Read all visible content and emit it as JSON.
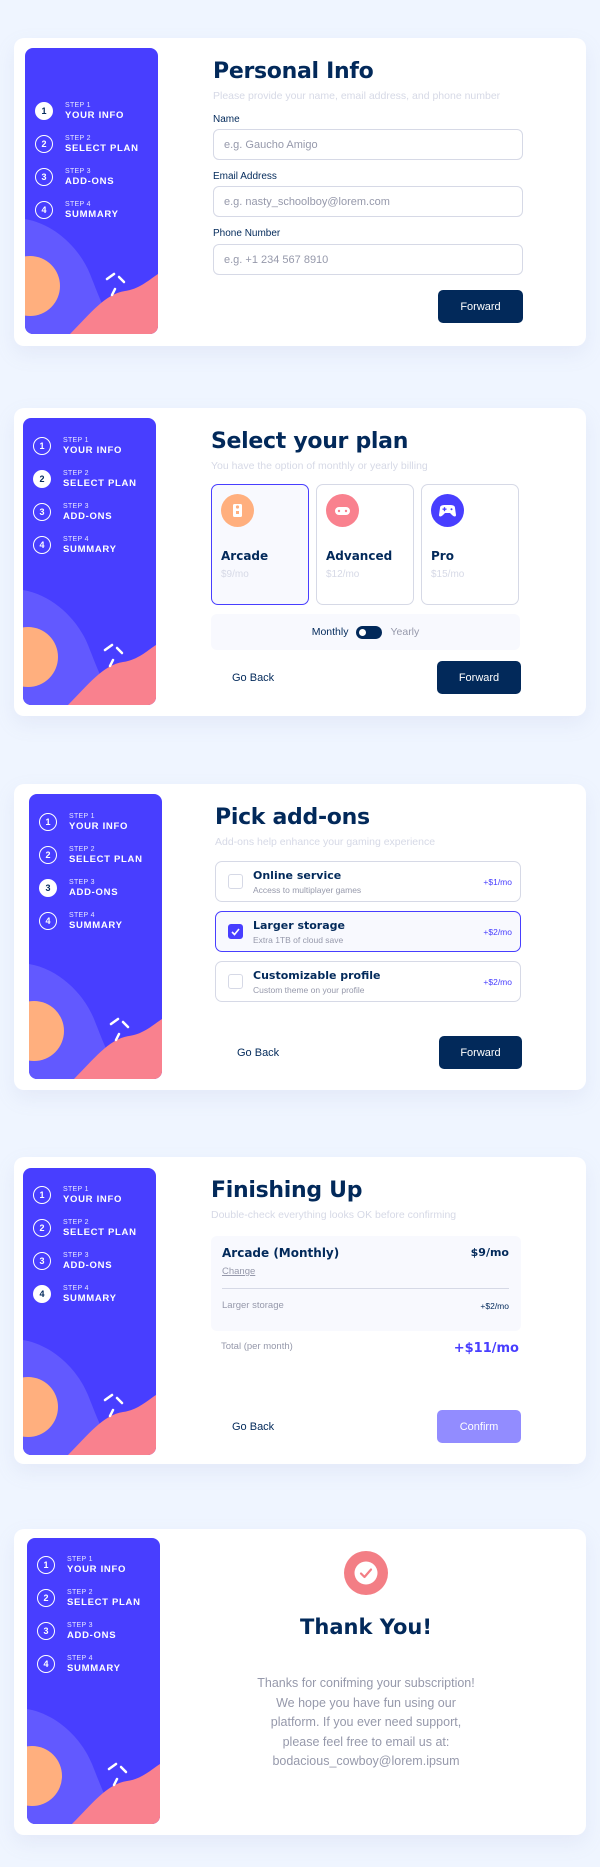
{
  "colors": {
    "page_bg": "#eff5ff",
    "sidebar": "#483eff",
    "marine": "#02295a",
    "purple": "#483eff",
    "light_gray": "#d6d9e6",
    "cool_gray": "#9699ab",
    "orange": "#f9818e",
    "light_blue": "#beE2fd"
  },
  "steps": [
    {
      "small": "STEP 1",
      "label": "YOUR INFO",
      "num": "1"
    },
    {
      "small": "STEP 2",
      "label": "SELECT PLAN",
      "num": "2"
    },
    {
      "small": "STEP 3",
      "label": "ADD-ONS",
      "num": "3"
    },
    {
      "small": "STEP 4",
      "label": "SUMMARY",
      "num": "4"
    }
  ],
  "personal": {
    "title": "Personal Info",
    "subtitle": "Please provide your name, email address, and phone number",
    "name_label": "Name",
    "name_placeholder": "e.g. Gaucho Amigo",
    "email_label": "Email Address",
    "email_placeholder": "e.g. nasty_schoolboy@lorem.com",
    "phone_label": "Phone Number",
    "phone_placeholder": "e.g. +1 234 567 8910",
    "forward": "Forward",
    "active_step": 1
  },
  "plan": {
    "title": "Select your plan",
    "subtitle": "You have the option of monthly or yearly billing",
    "plans": [
      {
        "name": "Arcade",
        "price": "$9/mo",
        "icon": "arcade-icon",
        "color": "#ffaf7e",
        "selected": true
      },
      {
        "name": "Advanced",
        "price": "$12/mo",
        "icon": "gamepad-icon",
        "color": "#f9818e",
        "selected": false
      },
      {
        "name": "Pro",
        "price": "$15/mo",
        "icon": "controller-icon",
        "color": "#483eff",
        "selected": false
      }
    ],
    "monthly": "Monthly",
    "yearly": "Yearly",
    "back": "Go Back",
    "forward": "Forward",
    "active_step": 2
  },
  "addons": {
    "title": "Pick add-ons",
    "subtitle": "Add-ons help enhance your gaming experience",
    "items": [
      {
        "name": "Online service",
        "desc": "Access to multiplayer games",
        "price": "+$1/mo",
        "checked": false
      },
      {
        "name": "Larger storage",
        "desc": "Extra 1TB of cloud save",
        "price": "+$2/mo",
        "checked": true
      },
      {
        "name": "Customizable profile",
        "desc": "Custom theme on your profile",
        "price": "+$2/mo",
        "checked": false
      }
    ],
    "back": "Go Back",
    "forward": "Forward",
    "active_step": 3
  },
  "summary": {
    "title": "Finishing Up",
    "subtitle": "Double-check everything looks OK before confirming",
    "plan_name": "Arcade (Monthly)",
    "plan_price": "$9/mo",
    "change": "Change",
    "addon_name": "Larger storage",
    "addon_price": "+$2/mo",
    "total_label": "Total (per month)",
    "total_price": "+$11/mo",
    "back": "Go Back",
    "confirm": "Confirm",
    "active_step": 4
  },
  "thanks": {
    "title": "Thank You!",
    "lines": [
      "Thanks for conifming your subscription!",
      "We hope you have fun using our",
      "platform. If you ever need support,",
      "please feel free to email us at:",
      "bodacious_cowboy@lorem.ipsum"
    ],
    "icon": "checkmark-icon",
    "active_step": 4
  }
}
